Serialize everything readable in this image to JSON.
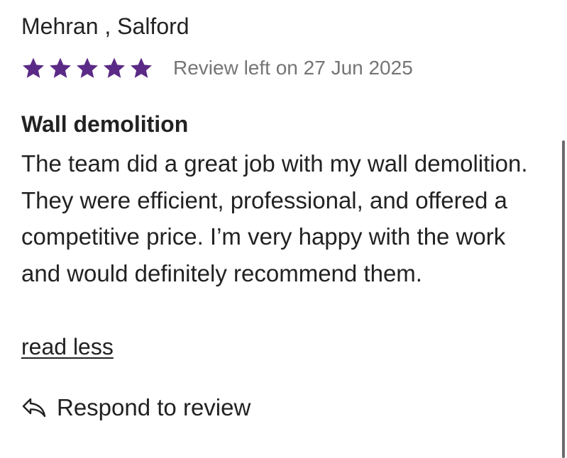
{
  "review": {
    "reviewer": "Mehran , Salford",
    "rating": 5,
    "rating_max": 5,
    "date_label": "Review left on 27 Jun 2025",
    "title": "Wall demolition",
    "body": "The team did a great job with my wall demolition. They were efficient, professional, and offered a competitive price. I’m very happy with the work and would definitely recommend them.",
    "toggle_label": "read less"
  },
  "actions": {
    "respond_label": "Respond to review",
    "respond_icon": "reply-arrow-icon"
  },
  "colors": {
    "star": "#5b2a86",
    "text": "#222222",
    "muted": "#757575"
  }
}
